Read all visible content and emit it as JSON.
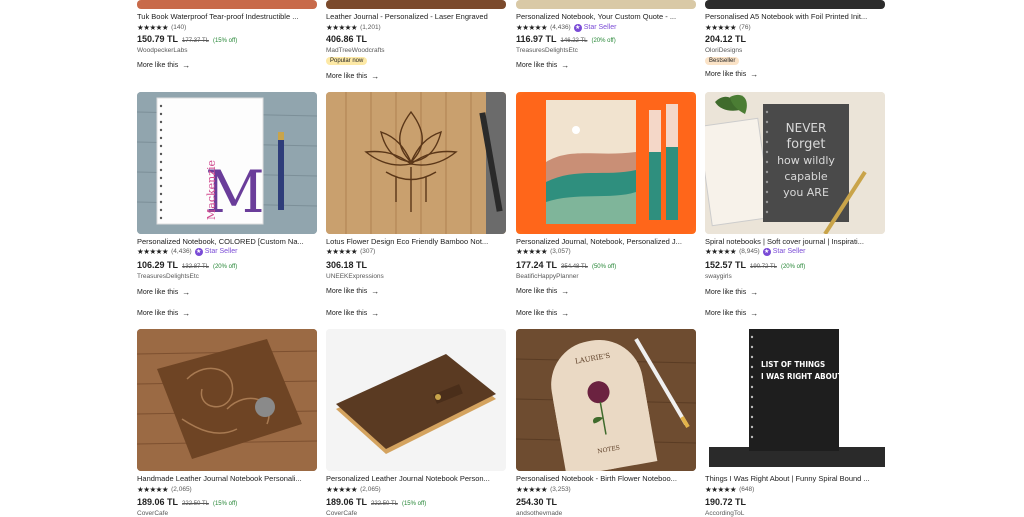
{
  "more_label": "More like this",
  "arrow": "→",
  "star_seller_label": "Star Seller",
  "stars": "★★★★★",
  "row1": [
    {
      "title": "Tuk Book Waterproof Tear-proof Indestructible ...",
      "count": "(140)",
      "price": "150.79 TL",
      "orig": "177.37 TL",
      "off": "(15% off)",
      "shop": "WoodpeckerLabs",
      "star_seller": false,
      "badge": ""
    },
    {
      "title": "Leather Journal - Personalized - Laser Engraved",
      "count": "(1,201)",
      "price": "406.86 TL",
      "orig": "",
      "off": "",
      "shop": "MadTreeWoodcrafts",
      "star_seller": false,
      "badge": "Popular now"
    },
    {
      "title": "Personalized Notebook, Your Custom Quote - ...",
      "count": "(4,436)",
      "price": "116.97 TL",
      "orig": "146.22 TL",
      "off": "(20% off)",
      "shop": "TreasuresDelightsEtc",
      "star_seller": true,
      "badge": ""
    },
    {
      "title": "Personalised A5 Notebook with Foil Printed Init...",
      "count": "(76)",
      "price": "204.12 TL",
      "orig": "",
      "off": "",
      "shop": "OloriDesigns",
      "star_seller": false,
      "badge": "Bestseller"
    }
  ],
  "row2": [
    {
      "title": "Personalized Notebook, COLORED [Custom Na...",
      "count": "(4,436)",
      "price": "106.29 TL",
      "orig": "132.87 TL",
      "off": "(20% off)",
      "shop": "TreasuresDelightsEtc",
      "star_seller": true,
      "image": "mackenzie-notebook"
    },
    {
      "title": "Lotus Flower Design Eco Friendly Bamboo Not...",
      "count": "(307)",
      "price": "306.18 TL",
      "orig": "",
      "off": "",
      "shop": "UNEEKExpressions",
      "star_seller": false,
      "image": "bamboo-notebook"
    },
    {
      "title": "Personalized Journal, Notebook, Personalized J...",
      "count": "(3,057)",
      "price": "177.24 TL",
      "orig": "354.48 TL",
      "off": "(50% off)",
      "shop": "BeatificHappyPlanner",
      "star_seller": false,
      "image": "landscape-journal"
    },
    {
      "title": "Spiral notebooks | Soft cover journal | Inspirati...",
      "count": "(8,945)",
      "price": "152.57 TL",
      "orig": "190.72 TL",
      "off": "(20% off)",
      "shop": "swaygirls",
      "star_seller": true,
      "image": "never-forget-notebook"
    }
  ],
  "row3": [
    {
      "title": "Handmade Leather Journal Notebook Personali...",
      "count": "(2,065)",
      "price": "189.06 TL",
      "orig": "222.50 TL",
      "off": "(15% off)",
      "shop": "CoverCafe"
    },
    {
      "title": "Personalized Leather Journal Notebook Person...",
      "count": "(2,065)",
      "price": "189.06 TL",
      "orig": "222.50 TL",
      "off": "(15% off)",
      "shop": "CoverCafe"
    },
    {
      "title": "Personalised Notebook - Birth Flower Noteboo...",
      "count": "(3,253)",
      "price": "254.30 TL",
      "orig": "",
      "off": "",
      "shop": "andsothevmade"
    },
    {
      "title": "Things I Was Right About | Funny Spiral Bound ...",
      "count": "(648)",
      "price": "190.72 TL",
      "orig": "",
      "off": "",
      "shop": "AccordingToL"
    }
  ],
  "image_text": {
    "mackenzie_name": "Mackenzie",
    "mackenzie_letter": "M",
    "never_forget": [
      "NEVER",
      "forget",
      "how wildly",
      "capable",
      "you ARE"
    ],
    "birth_flower_top": "LAURIE'S",
    "birth_flower_bottom": "NOTES",
    "things_right": [
      "LIST OF THINGS",
      "I WAS RIGHT ABOUT"
    ]
  }
}
